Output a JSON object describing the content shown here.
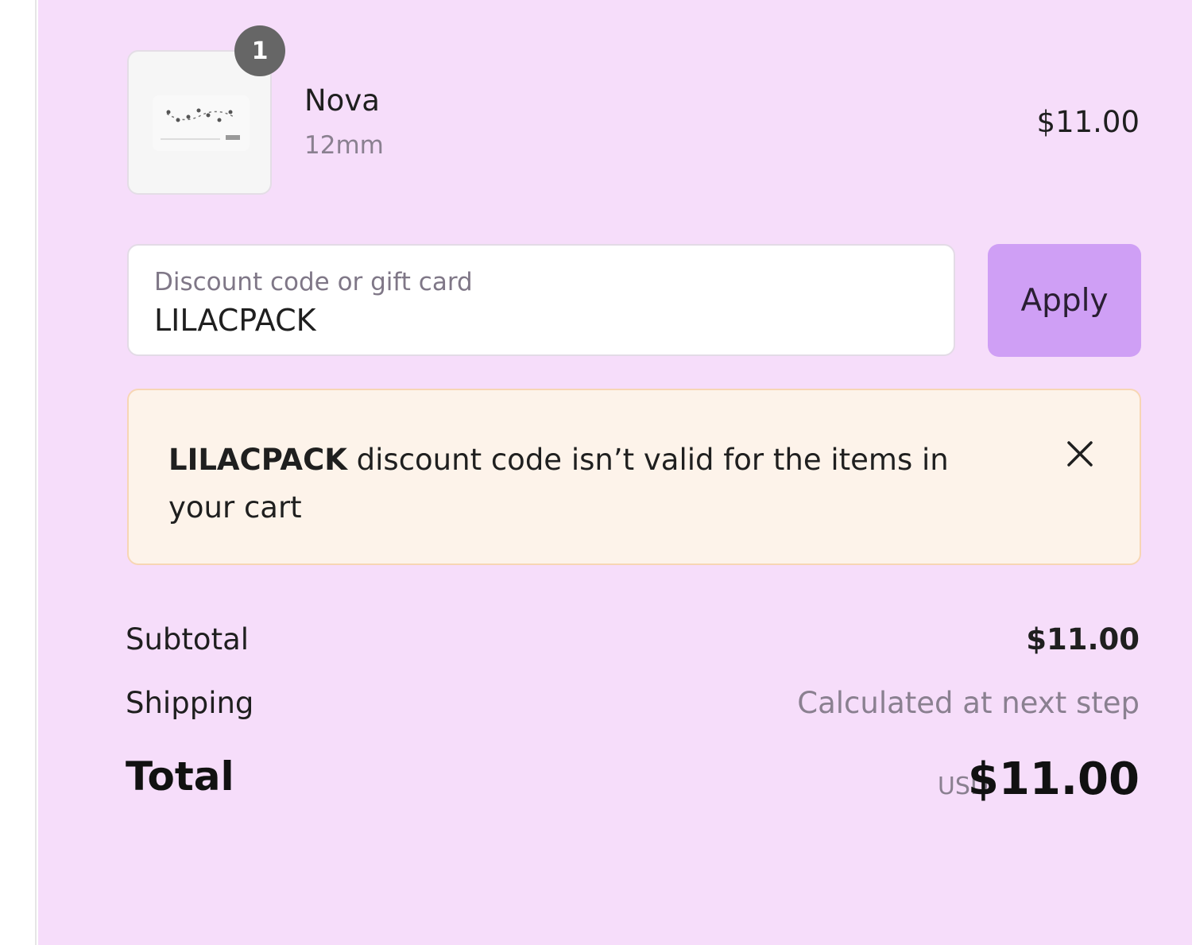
{
  "line_item": {
    "quantity": "1",
    "name": "Nova",
    "variant": "12mm",
    "price": "$11.00"
  },
  "discount": {
    "label": "Discount code or gift card",
    "value": "LILACPACK",
    "apply_label": "Apply"
  },
  "warning": {
    "code": "LILACPACK",
    "message": " discount code isn’t valid for the items in your cart"
  },
  "summary": {
    "subtotal_label": "Subtotal",
    "subtotal_value": "$11.00",
    "shipping_label": "Shipping",
    "shipping_value": "Calculated at next step",
    "total_label": "Total",
    "currency": "USD",
    "total_value": "$11.00"
  },
  "colors": {
    "panel_bg": "#f6ddfa",
    "apply_button": "#cf9ff5",
    "warning_bg": "#fdf3ea",
    "warning_border": "#f7d6b4"
  }
}
